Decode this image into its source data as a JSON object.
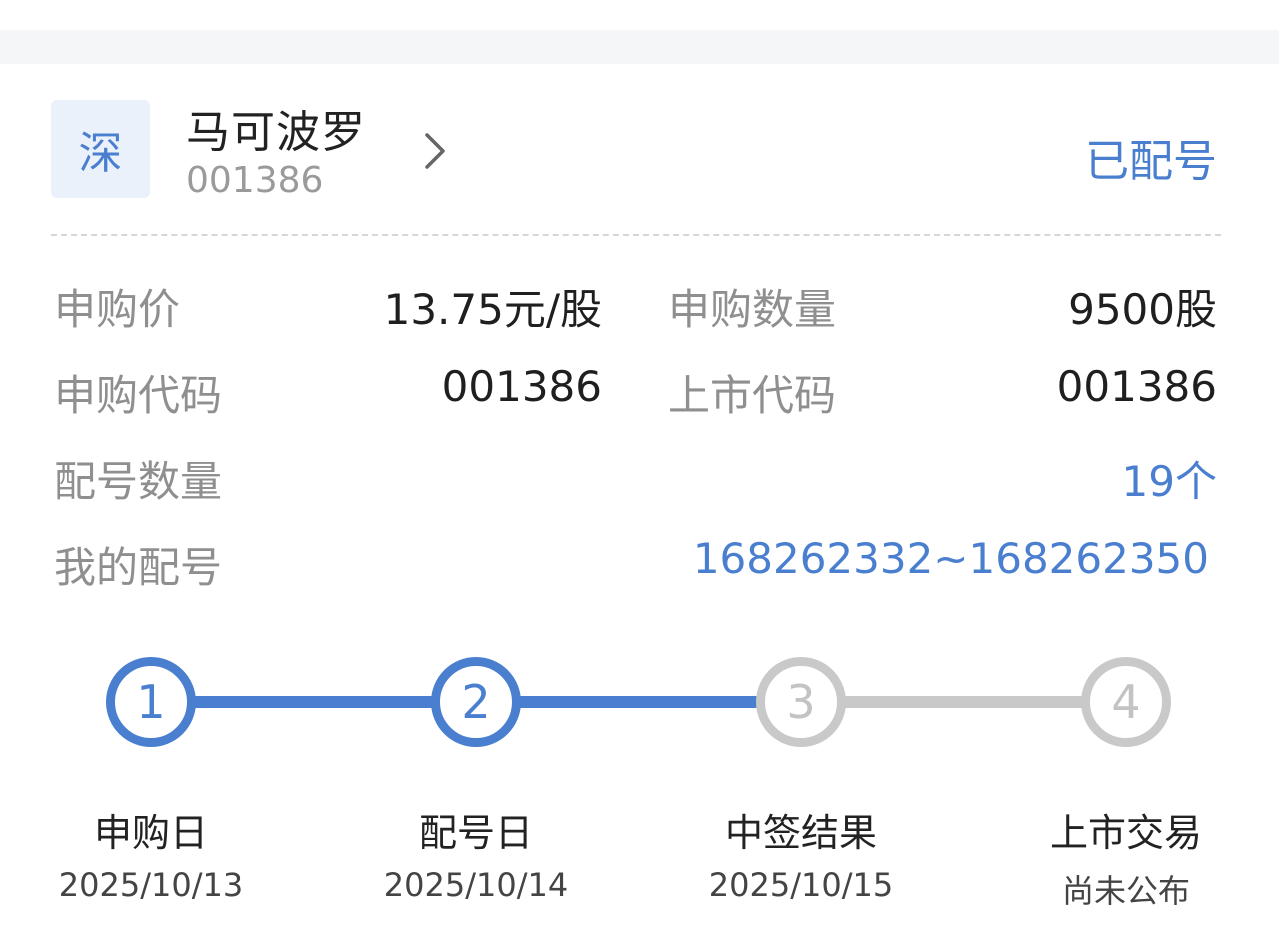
{
  "header": {
    "market_badge": "深",
    "stock_name": "马可波罗",
    "stock_code": "001386",
    "status": "已配号"
  },
  "info": {
    "subscribe_price_label": "申购价",
    "subscribe_price_value": "13.75元/股",
    "subscribe_qty_label": "申购数量",
    "subscribe_qty_value": "9500股",
    "subscribe_code_label": "申购代码",
    "subscribe_code_value": "001386",
    "listing_code_label": "上市代码",
    "listing_code_value": "001386",
    "allot_count_label": "配号数量",
    "allot_count_value": "19个",
    "my_allot_label": "我的配号",
    "my_allot_value": "168262332~168262350"
  },
  "progress": {
    "steps": [
      {
        "number": "1",
        "label": "申购日",
        "date": "2025/10/13",
        "state": "done"
      },
      {
        "number": "2",
        "label": "配号日",
        "date": "2025/10/14",
        "state": "done"
      },
      {
        "number": "3",
        "label": "中签结果",
        "date": "2025/10/15",
        "state": "todo"
      },
      {
        "number": "4",
        "label": "上市交易",
        "date": "尚未公布",
        "state": "todo"
      }
    ]
  },
  "colors": {
    "accent": "#4a7fd0",
    "inactive": "#c9c9c9",
    "label_gray": "#8f8f8f",
    "badge_bg": "#eaf1fb"
  },
  "icons": {
    "chevron": "chevron-right-icon"
  }
}
